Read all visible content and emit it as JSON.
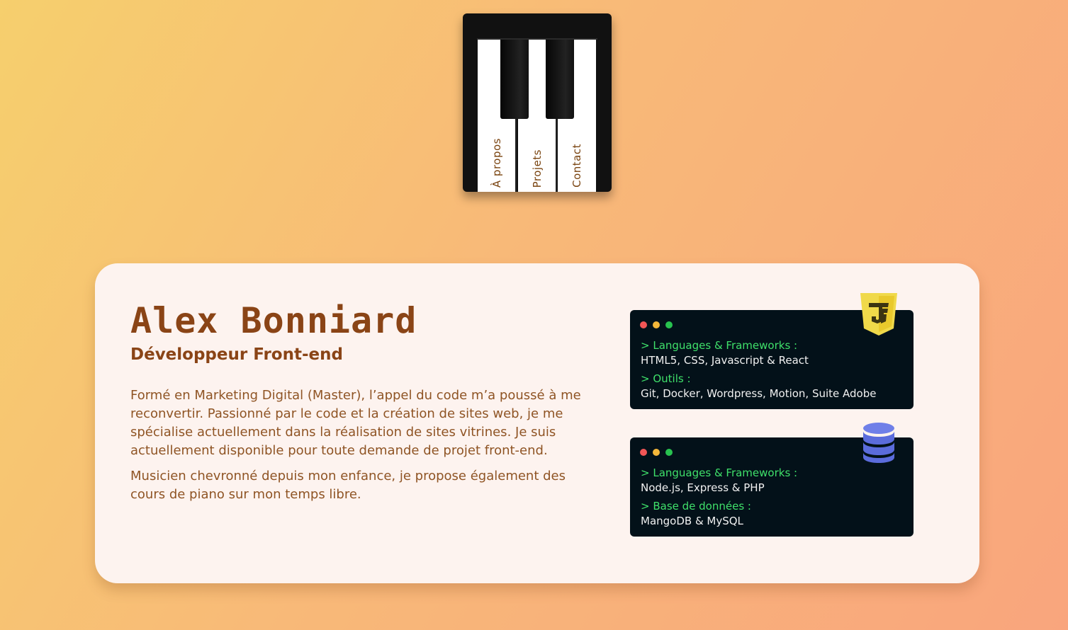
{
  "nav": {
    "keys": [
      {
        "label": "À propos"
      },
      {
        "label": "Projets"
      },
      {
        "label": "Contact"
      }
    ]
  },
  "profile": {
    "name": "Alex Bonniard",
    "role": "Développeur Front-end",
    "bio": [
      "Formé en Marketing Digital (Master), l’appel du code m’a poussé à me reconvertir. Passionné par le code et la création de sites web, je me spécialise actuellement dans la réalisation de sites vitrines. Je suis actuellement disponible pour toute demande de projet front-end.",
      "Musicien chevronné depuis mon enfance, je propose également des cours de piano sur mon temps libre."
    ]
  },
  "frontend_terminal": {
    "badge_icon": "javascript-shield-icon",
    "lines": [
      {
        "prompt": "> Languages & Frameworks :",
        "value": "HTML5, CSS, Javascript & React"
      },
      {
        "prompt": "> Outils :",
        "value": "Git, Docker, Wordpress, Motion, Suite Adobe"
      }
    ]
  },
  "backend_terminal": {
    "badge_icon": "database-icon",
    "lines": [
      {
        "prompt": "> Languages & Frameworks :",
        "value": "Node.js, Express & PHP"
      },
      {
        "prompt": "> Base de données :",
        "value": "MangoDB & MySQL"
      }
    ]
  },
  "colors": {
    "accent_brown": "#8a4416",
    "terminal_bg": "#031119",
    "prompt_green": "#3fe06a",
    "card_bg": "#fdf3ef"
  }
}
